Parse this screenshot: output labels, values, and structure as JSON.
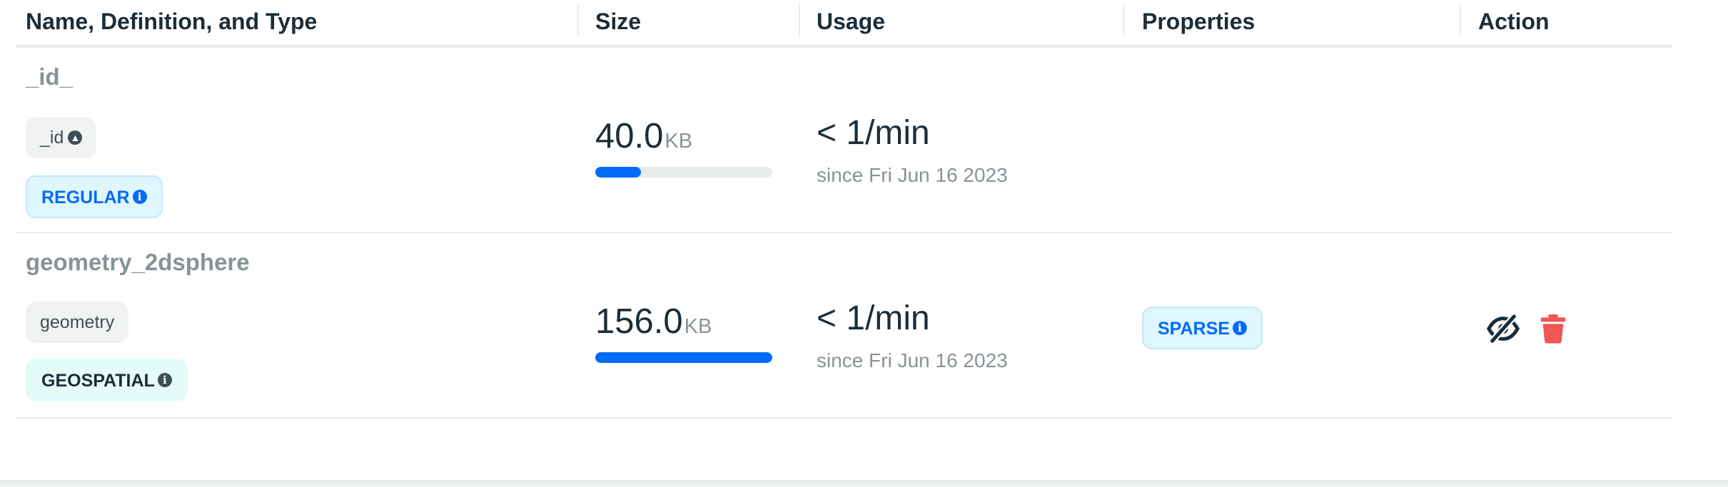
{
  "columns": [
    "Name, Definition, and Type",
    "Size",
    "Usage",
    "Properties",
    "Action"
  ],
  "indexes": [
    {
      "name": "_id_",
      "field": "_id",
      "field_icon": "arrow-up-circle-icon",
      "type": "REGULAR",
      "type_icon": "info-icon",
      "size": {
        "value": "40.0",
        "unit": "KB",
        "fraction": 0.26
      },
      "usage": {
        "rate": "< 1/min",
        "since": "since Fri Jun 16 2023"
      },
      "properties": [],
      "actions": []
    },
    {
      "name": "geometry_2dsphere",
      "field": "geometry",
      "type": "GEOSPATIAL",
      "type_icon": "info-icon",
      "size": {
        "value": "156.0",
        "unit": "KB",
        "fraction": 1.0
      },
      "usage": {
        "rate": "< 1/min",
        "since": "since Fri Jun 16 2023"
      },
      "properties": [
        {
          "label": "SPARSE",
          "icon": "info-icon"
        }
      ],
      "actions": [
        "hide-index-icon",
        "delete-icon"
      ]
    }
  ],
  "colors": {
    "text_primary": "#1c2d38",
    "text_muted": "#889397",
    "accent_blue": "#016bf8",
    "badge_blue_bg": "#e1f7ff",
    "badge_teal_bg": "#e3fcf7",
    "delete_red": "#ef5752",
    "divider": "#e8edeb"
  }
}
